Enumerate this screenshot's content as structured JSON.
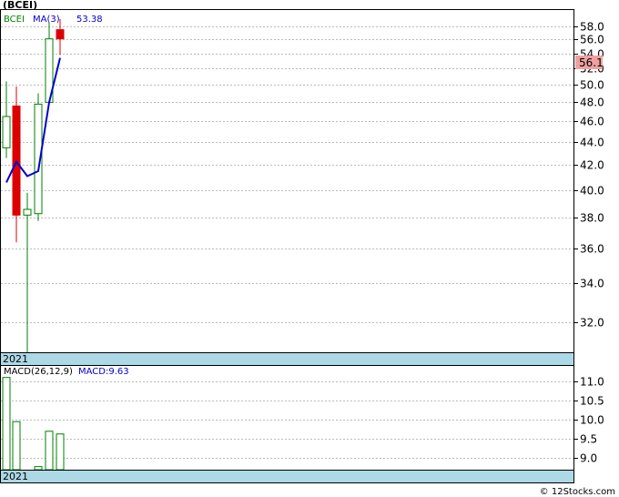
{
  "chart_data": [
    {
      "type": "candlestick",
      "title": "(BCEI)",
      "ticker": "BCEI",
      "indicator": "MA(3)",
      "indicator_value": "53.38",
      "last_price": "56.1",
      "year_label": "2021",
      "ylim": [
        30.6,
        60.6
      ],
      "yticks": [
        "32.0",
        "34.0",
        "36.0",
        "38.0",
        "40.0",
        "42.0",
        "44.0",
        "46.0",
        "48.0",
        "50.0",
        "52.0",
        "54.0",
        "56.0",
        "58.0"
      ],
      "candles": [
        {
          "open": 43.5,
          "close": 46.5,
          "high": 50.4,
          "low": 42.6,
          "up": true
        },
        {
          "open": 47.6,
          "close": 38.2,
          "high": 49.8,
          "low": 36.4,
          "up": false
        },
        {
          "open": 38.2,
          "close": 38.6,
          "high": 39.8,
          "low": 30.6,
          "up": true
        },
        {
          "open": 38.3,
          "close": 47.8,
          "high": 49.0,
          "low": 37.8,
          "up": true
        },
        {
          "open": 48.0,
          "close": 56.1,
          "high": 58.6,
          "low": 48.0,
          "up": true
        },
        {
          "open": 57.5,
          "close": 56.1,
          "high": 59.2,
          "low": 53.8,
          "up": false
        }
      ],
      "ma": [
        40.6,
        42.3,
        41.1,
        41.5,
        48.0,
        53.4
      ],
      "colors": {
        "up": "#008000",
        "down": "#dd0000",
        "ma": "#0000cc",
        "axis_band": "#add8e6",
        "price_box": "#f0a0a0"
      }
    },
    {
      "type": "bar",
      "title": "MACD(26,12,9)",
      "indicator": "MACD",
      "indicator_value": "9.63",
      "macd_label": "MACD:9.63",
      "year_label": "2021",
      "ylim": [
        8.7,
        11.4
      ],
      "yticks": [
        "9.0",
        "9.5",
        "10.0",
        "10.5",
        "11.0"
      ],
      "values": [
        11.1,
        9.95,
        null,
        8.78,
        9.7,
        9.63
      ]
    }
  ],
  "footer": "© 12Stocks.com"
}
